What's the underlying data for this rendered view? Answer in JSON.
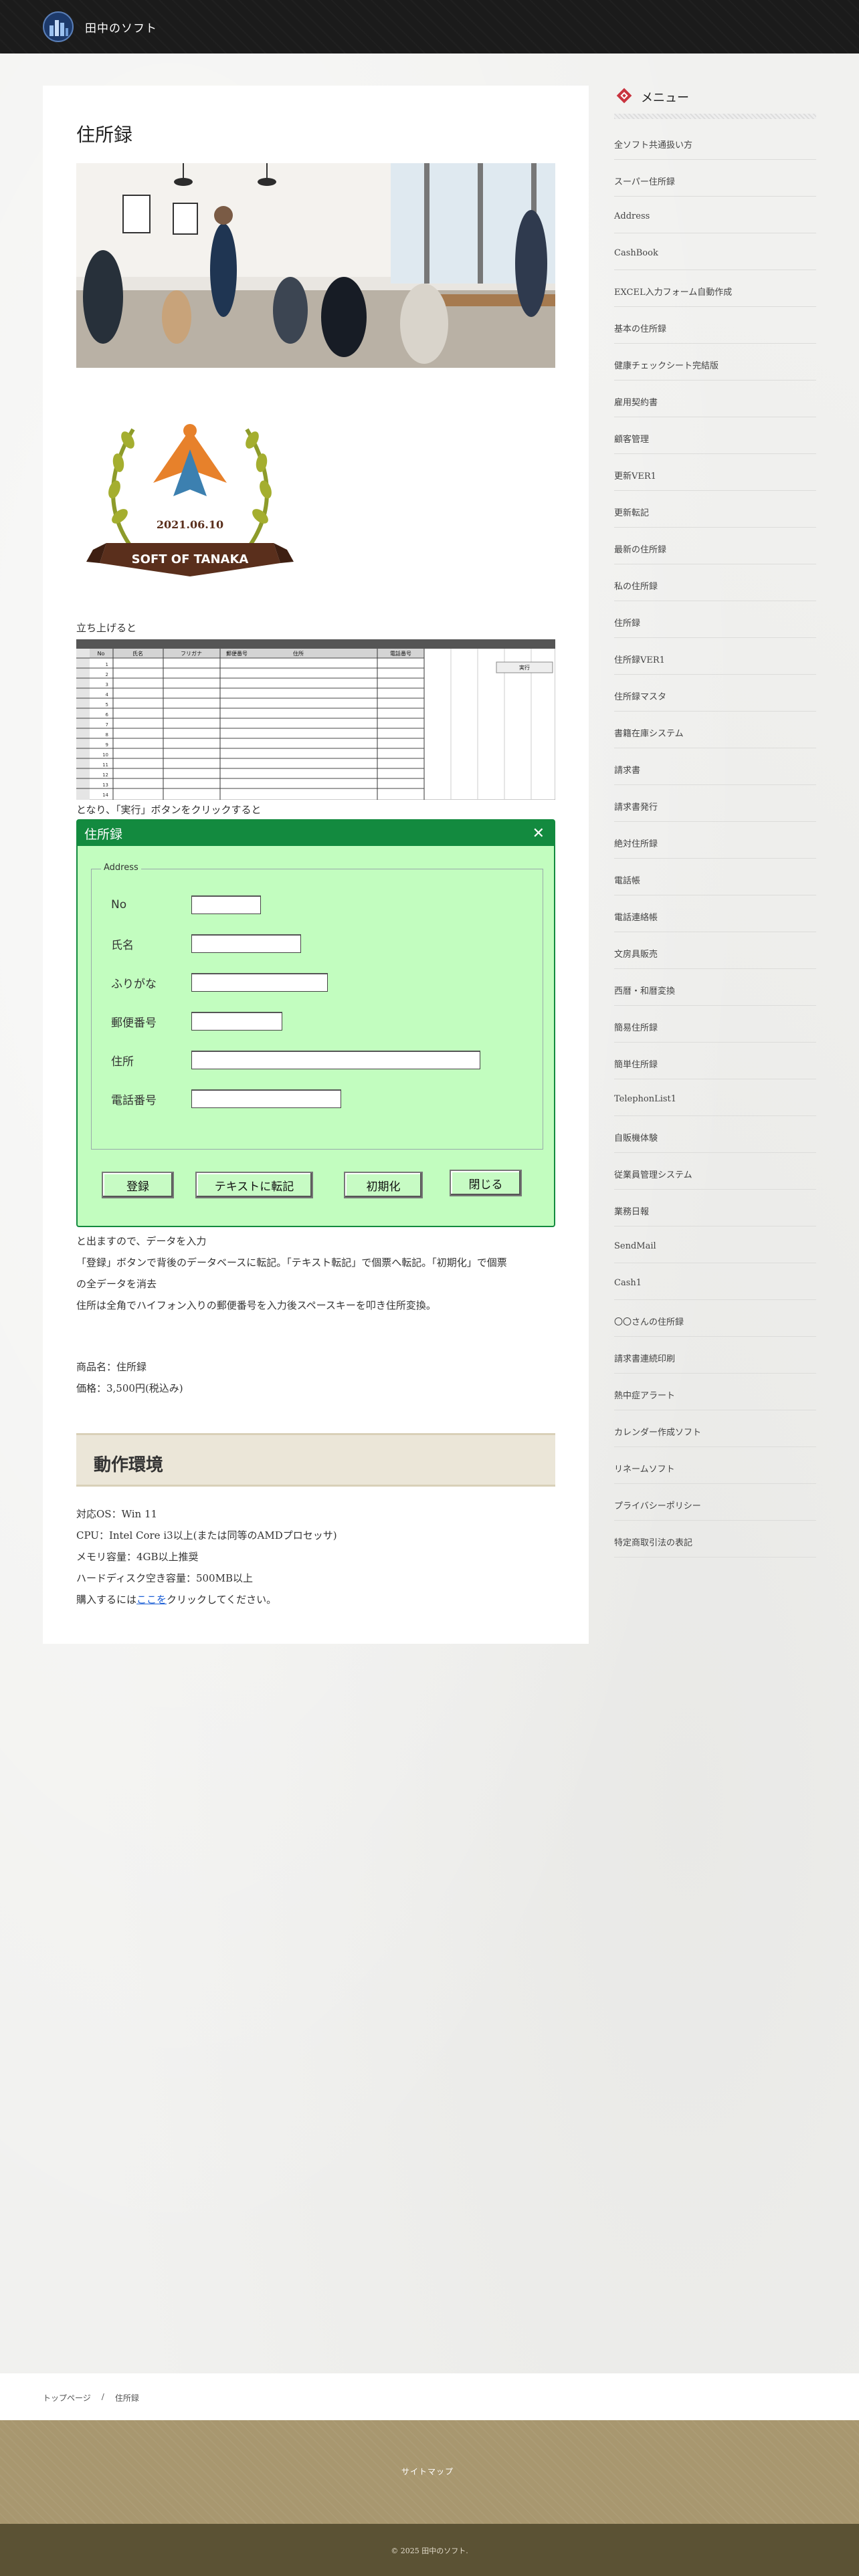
{
  "site": {
    "title": "田中のソフト"
  },
  "article": {
    "title": "住所録",
    "badge": {
      "date": "2021.06.10",
      "ribbon_text": "SOFT OF TANAKA"
    },
    "intro": "立ち上げると",
    "sheet": {
      "columns": [
        "No",
        "氏名",
        "フリガナ",
        "郵便番号",
        "住所",
        "電話番号"
      ],
      "button_label": "実行",
      "row_numbers": [
        "1",
        "2",
        "3",
        "4",
        "5",
        "6",
        "7",
        "8",
        "9",
        "10",
        "11",
        "12",
        "13",
        "14"
      ]
    },
    "after_sheet": "となり、「実行」ボタンをクリックすると",
    "userform": {
      "title": "住所録",
      "close_glyph": "✕",
      "frame_label": "Address",
      "fields": {
        "no": "No",
        "name": "氏名",
        "kana": "ふりがな",
        "zip": "郵便番号",
        "address": "住所",
        "phone": "電話番号"
      },
      "buttons": {
        "register": "登録",
        "text_export": "テキストに転記",
        "initialize": "初期化",
        "close": "閉じる"
      }
    },
    "description": [
      "と出ますので、データを入力",
      "「登録」ボタンで背後のデータベースに転記。「テキスト転記」で個票へ転記。「初期化」で個票",
      "の全データを消去",
      "住所は全角でハイフォン入りの郵便番号を入力後スペースキーを叩き住所変換。"
    ],
    "product": {
      "name": "商品名：住所録",
      "price": "価格：3,500円(税込み)"
    },
    "env_heading": "動作環境",
    "spec": {
      "os": "対応OS：Win 11",
      "cpu": "CPU：Intel Core i3以上(または同等のAMDプロセッサ)",
      "memory": "メモリ容量：4GB以上推奨",
      "disk": "ハードディスク空き容量：500MB以上",
      "purchase_prefix": "購入するには",
      "purchase_link": "ここを",
      "purchase_suffix": "クリックしてください。"
    }
  },
  "sidebar": {
    "title": "メニュー",
    "items": [
      "全ソフト共通扱い方",
      "スーパー住所録",
      "Address",
      "CashBook",
      "EXCEL入力フォーム自動作成",
      "基本の住所録",
      "健康チェックシート完結版",
      "雇用契約書",
      "顧客管理",
      "更新VER1",
      "更新転記",
      "最新の住所録",
      "私の住所録",
      "住所録",
      "住所録VER1",
      "住所録マスタ",
      "書籍在庫システム",
      "請求書",
      "請求書発行",
      "絶対住所録",
      "電話帳",
      "電話連絡帳",
      "文房具販売",
      "西暦・和暦変換",
      "簡易住所録",
      "簡単住所録",
      "TelephonList1",
      "自販機体験",
      "従業員管理システム",
      "業務日報",
      "SendMail",
      "Cash1",
      "〇〇さんの住所録",
      "請求書連続印刷",
      "熱中症アラート",
      "カレンダー作成ソフト",
      "リネームソフト",
      "プライバシーポリシー",
      "特定商取引法の表記"
    ]
  },
  "breadcrumb": {
    "home": "トップページ",
    "separator": "/",
    "current": "住所録"
  },
  "footer": {
    "sitemap": "サイトマップ",
    "copyright": "© 2025 田中のソフト."
  },
  "colors": {
    "header_bg": "#1b1b1b",
    "form_bg": "#c2fdbf",
    "form_titlebar": "#138a3f",
    "footer_nav_bg": "#a8976f",
    "footer_bottom_bg": "#5b5234",
    "link": "#1c5fd6"
  }
}
